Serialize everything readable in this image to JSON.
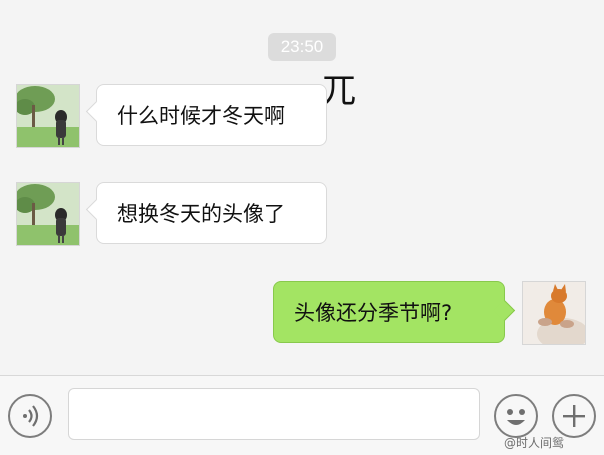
{
  "chat": {
    "timestamp": "23:50",
    "stray_text": "兀",
    "messages": [
      {
        "side": "left",
        "avatar": "girl-in-park-avatar",
        "text": "什么时候才冬天啊"
      },
      {
        "side": "left",
        "avatar": "girl-in-park-avatar",
        "text": "想换冬天的头像了"
      },
      {
        "side": "right",
        "avatar": "orange-cat-avatar",
        "text": "头像还分季节啊?"
      }
    ]
  },
  "input_bar": {
    "voice_icon": "voice-icon",
    "input_value": "",
    "emoji_icon": "emoji-icon",
    "plus_icon": "plus-icon"
  },
  "watermark": "@时人间鸳",
  "colors": {
    "background": "#f4f4f4",
    "timestamp_bg": "#dcdcdc",
    "bubble_left": "#ffffff",
    "bubble_right": "#a3e463",
    "input_bar": "#f7f7f7"
  }
}
